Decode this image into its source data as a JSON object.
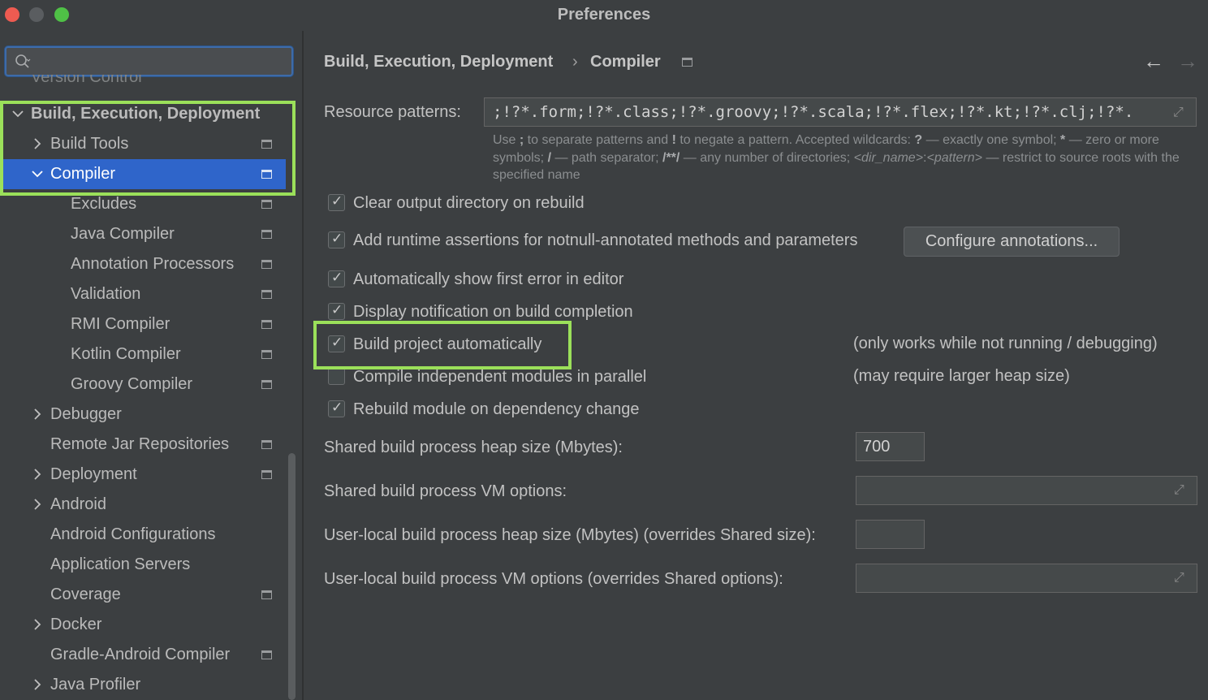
{
  "window": {
    "title": "Preferences"
  },
  "search": {
    "value": ""
  },
  "sidebar": {
    "cut_item": "Version Control",
    "items": [
      {
        "label": "Build, Execution, Deployment",
        "expanded": true
      },
      {
        "label": "Build Tools",
        "expanded": false
      },
      {
        "label": "Compiler",
        "expanded": true,
        "selected": true
      },
      {
        "label": "Excludes"
      },
      {
        "label": "Java Compiler"
      },
      {
        "label": "Annotation Processors"
      },
      {
        "label": "Validation"
      },
      {
        "label": "RMI Compiler"
      },
      {
        "label": "Kotlin Compiler"
      },
      {
        "label": "Groovy Compiler"
      },
      {
        "label": "Debugger",
        "expanded": false
      },
      {
        "label": "Remote Jar Repositories"
      },
      {
        "label": "Deployment",
        "expanded": false
      },
      {
        "label": "Android",
        "expanded": false
      },
      {
        "label": "Android Configurations"
      },
      {
        "label": "Application Servers"
      },
      {
        "label": "Coverage"
      },
      {
        "label": "Docker",
        "expanded": false
      },
      {
        "label": "Gradle-Android Compiler"
      },
      {
        "label": "Java Profiler",
        "expanded": false
      }
    ]
  },
  "breadcrumb": {
    "parent": "Build, Execution, Deployment",
    "separator": "›",
    "current": "Compiler"
  },
  "nav": {
    "back": "←",
    "forward": "→"
  },
  "resource_patterns": {
    "label": "Resource patterns:",
    "value": ";!?*.form;!?*.class;!?*.groovy;!?*.scala;!?*.flex;!?*.kt;!?*.clj;!?*."
  },
  "hint": {
    "p1": "Use ",
    "semicolon": ";",
    "p2": " to separate patterns and ",
    "bang": "!",
    "p3": " to negate a pattern. Accepted wildcards: ",
    "q": "?",
    "p4": " — exactly one symbol; ",
    "star": "*",
    "p5": " — zero or more symbols; ",
    "slash": "/",
    "p6": " — path separator; ",
    "dstar": "/**/",
    "p7": " — any number of directories; ",
    "dir": "<dir_name>",
    "colon": ":",
    "pattern": "<pattern>",
    "p8": " — restrict to source roots with the specified name"
  },
  "options": [
    {
      "label": "Clear output directory on rebuild",
      "checked": true
    },
    {
      "label": "Add runtime assertions for notnull-annotated methods and parameters",
      "checked": true
    },
    {
      "label": "Automatically show first error in editor",
      "checked": true
    },
    {
      "label": "Display notification on build completion",
      "checked": true
    },
    {
      "label": "Build project automatically",
      "checked": true
    },
    {
      "label": "Compile independent modules in parallel",
      "checked": false
    },
    {
      "label": "Rebuild module on dependency change",
      "checked": true
    }
  ],
  "notes": {
    "build_auto": "(only works while not running / debugging)",
    "parallel": "(may require larger heap size)"
  },
  "configure_button": "Configure annotations...",
  "fields": {
    "heap_label": "Shared build process heap size (Mbytes):",
    "heap_value": "700",
    "vm_label": "Shared build process VM options:",
    "vm_value": "",
    "user_heap_label": "User-local build process heap size (Mbytes) (overrides Shared size):",
    "user_heap_value": "",
    "user_vm_label": "User-local build process VM options (overrides Shared options):",
    "user_vm_value": ""
  },
  "colors": {
    "highlight": "#9be05a",
    "selection": "#2f65ca",
    "background": "#3c3f41"
  }
}
